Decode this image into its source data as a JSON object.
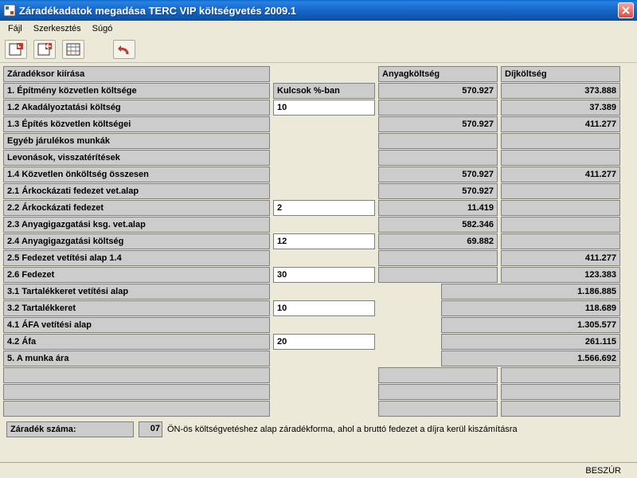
{
  "window": {
    "title": "Záradékadatok megadása     TERC VIP költségvetés 2009.1"
  },
  "menu": {
    "file": "Fájl",
    "edit": "Szerkesztés",
    "help": "Súgó"
  },
  "headers": {
    "label": "Záradéksor kiírása",
    "pct": "Kulcsok %-ban",
    "mat": "Anyagköltség",
    "fee": "Díjköltség"
  },
  "rows": [
    {
      "label": "1. Építmény közvetlen költsége",
      "input": null,
      "showPctHeader": true,
      "mat": "570.927",
      "fee": "373.888"
    },
    {
      "label": "1.2 Akadályoztatási költség",
      "input": "10",
      "mat": "",
      "fee": "37.389"
    },
    {
      "label": "1.3 Építés közvetlen költségei",
      "input": null,
      "mat": "570.927",
      "fee": "411.277"
    },
    {
      "label": "Egyéb járulékos munkák",
      "input": null,
      "mat": "",
      "fee": ""
    },
    {
      "label": "Levonások, visszatérítések",
      "input": null,
      "mat": "",
      "fee": ""
    },
    {
      "label": "1.4 Közvetlen önköltség összesen",
      "input": null,
      "mat": "570.927",
      "fee": "411.277"
    },
    {
      "label": "2.1 Árkockázati fedezet vet.alap",
      "input": null,
      "mat": "570.927",
      "fee": ""
    },
    {
      "label": "2.2 Árkockázati fedezet",
      "input": "2",
      "mat": "11.419",
      "fee": ""
    },
    {
      "label": "2.3 Anyagigazgatási ksg. vet.alap",
      "input": null,
      "mat": "582.346",
      "fee": ""
    },
    {
      "label": "2.4 Anyagigazgatási költség",
      "input": "12",
      "mat": "69.882",
      "fee": ""
    },
    {
      "label": "2.5 Fedezet vetítési alap 1.4",
      "input": null,
      "mat": "",
      "fee": "411.277"
    },
    {
      "label": "2.6 Fedezet",
      "input": "30",
      "mat": "",
      "fee": "123.383"
    }
  ],
  "merged_rows": [
    {
      "label": "3.1 Tartalékkeret vetítési alap",
      "input": null,
      "val": "1.186.885"
    },
    {
      "label": "3.2 Tartalékkeret",
      "input": "10",
      "val": "118.689"
    },
    {
      "label": "4.1 ÁFA vetítési alap",
      "input": null,
      "val": "1.305.577"
    },
    {
      "label": "4.2 Áfa",
      "input": "20",
      "val": "261.115"
    },
    {
      "label": "5.  A munka ára",
      "input": null,
      "val": "1.566.692"
    }
  ],
  "footer": {
    "label": "Záradék száma:",
    "num": "07",
    "desc": "ÖN-ös költségvetéshez alap záradékforma, ahol a bruttó fedezet a díjra kerül kiszámításra"
  },
  "status": {
    "insert": "BESZÚR"
  }
}
